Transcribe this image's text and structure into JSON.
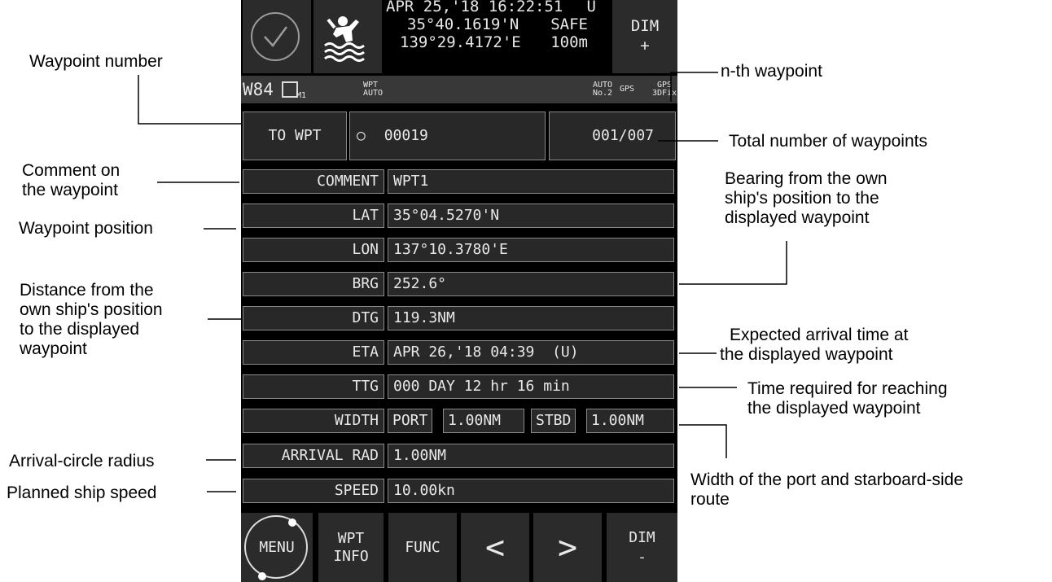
{
  "header": {
    "datetime": "APR 25,'18 16:22:51",
    "utc_flag": "U",
    "lat": "35°40.1619'N",
    "lon": "139°29.4172'E",
    "safe": "SAFE",
    "depth": "100m",
    "dim_plus": [
      "DIM",
      "+"
    ]
  },
  "status_bar": {
    "screen_id": "W84",
    "mode_sub": "M1",
    "wpt_line1": "WPT",
    "wpt_line2": "AUTO",
    "auto_line1": "AUTO",
    "auto_line2": "No.2",
    "gps": "GPS",
    "gps_fix_line1": "GPS",
    "gps_fix_line2": "3DFix"
  },
  "to_wpt": {
    "label": "TO WPT",
    "marker": "○",
    "number": "00019",
    "count": "001/007"
  },
  "rows": [
    {
      "label": "COMMENT",
      "value": "WPT1"
    },
    {
      "label": "LAT",
      "value": "35°04.5270'N"
    },
    {
      "label": "LON",
      "value": "137°10.3780'E"
    },
    {
      "label": "BRG",
      "value": "252.6°"
    },
    {
      "label": "DTG",
      "value": "119.3NM"
    },
    {
      "label": "ETA",
      "value": "APR 26,'18 04:39  (U)"
    },
    {
      "label": "TTG",
      "value": "000 DAY 12 hr 16 min"
    },
    {
      "label": "WIDTH",
      "port_label": "PORT",
      "port_value": "1.00NM",
      "stbd_label": "STBD",
      "stbd_value": "1.00NM"
    },
    {
      "label": "ARRIVAL RAD",
      "value": "1.00NM"
    },
    {
      "label": "SPEED",
      "value": "10.00kn"
    }
  ],
  "bottom_bar": {
    "menu": "MENU",
    "wpt_info": [
      "WPT",
      "INFO"
    ],
    "func": "FUNC",
    "prev": "<",
    "next": ">",
    "dim_minus": [
      "DIM",
      "-"
    ]
  },
  "annotations": {
    "waypoint_number": "Waypoint number",
    "nth_waypoint": "n-th waypoint",
    "total_waypoints": "Total number of waypoints",
    "comment": [
      "Comment on",
      "the waypoint"
    ],
    "position": "Waypoint position",
    "bearing": [
      "Bearing from the own",
      "ship's position to the",
      "displayed waypoint"
    ],
    "distance": [
      "Distance from the",
      "own ship's position",
      "to the displayed",
      "waypoint"
    ],
    "eta": [
      "Expected arrival time at",
      "the displayed waypoint"
    ],
    "ttg": [
      "Time required for reaching",
      "the displayed waypoint"
    ],
    "arrival_radius": "Arrival-circle radius",
    "speed": "Planned ship speed",
    "width": [
      "Width of the port and starboard-side",
      "route"
    ]
  }
}
